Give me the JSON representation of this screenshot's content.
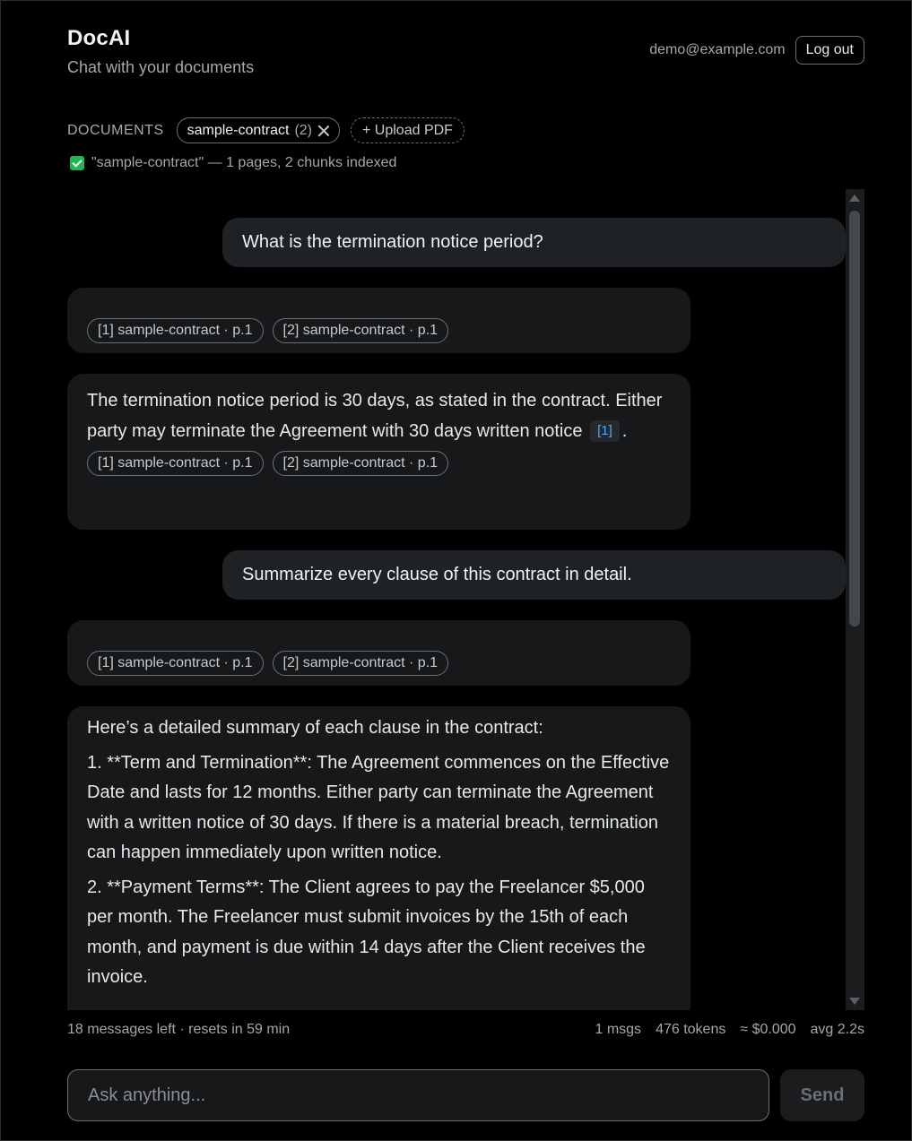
{
  "header": {
    "title": "DocAI",
    "subtitle": "Chat with your documents",
    "user_email": "demo@example.com",
    "logout_label": "Log out"
  },
  "documents": {
    "label": "DOCUMENTS",
    "chip_name": "sample-contract",
    "chip_count": "(2)",
    "upload_label": "+ Upload PDF",
    "status_text": "\"sample-contract\" — 1 pages, 2 chunks indexed"
  },
  "citations": [
    "[1] sample-contract · p.1",
    "[2] sample-contract · p.1"
  ],
  "messages": {
    "user_1": "What is the termination notice period?",
    "assistant_2_line_a": "The termination notice period is 30 days, as stated in the contract. Either party may terminate the Agreement with 30 days written notice",
    "assistant_2_cite": "[1]",
    "assistant_2_line_b": ".",
    "user_2": "Summarize every clause of this contract in detail.",
    "assistant_4_intro": "Here’s a detailed summary of each clause in the contract:",
    "assistant_4_p1": "1. **Term and Termination**: The Agreement commences on the Effective Date and lasts for 12 months. Either party can terminate the Agreement with a written notice of 30 days. If there is a material breach, termination can happen immediately upon written notice.",
    "assistant_4_p2": "2. **Payment Terms**: The Client agrees to pay the Freelancer $5,000 per month. The Freelancer must submit invoices by the 15th of each month, and payment is due within 14 days after the Client receives the invoice."
  },
  "footer": {
    "quota": "18 messages left · resets in 59 min",
    "msgs": "1 msgs",
    "tokens": "476 tokens",
    "cost": "≈ $0.000",
    "avg": "avg 2.2s"
  },
  "composer": {
    "placeholder": "Ask anything...",
    "send_label": "Send"
  }
}
